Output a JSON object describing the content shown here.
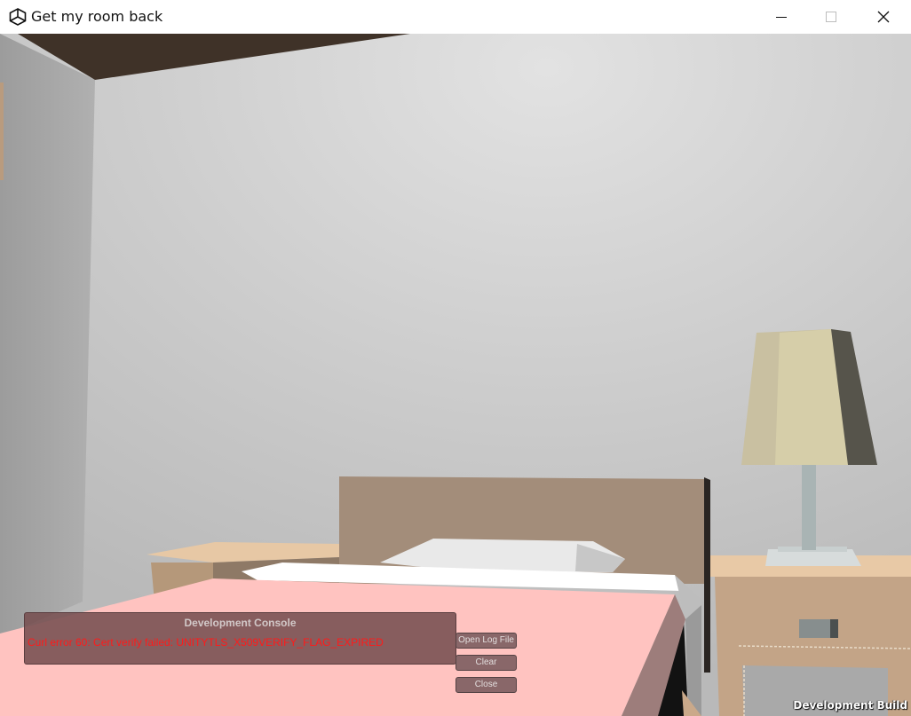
{
  "window": {
    "title": "Get my room back",
    "app_icon": "unity-logo-icon",
    "controls": {
      "minimize_icon": "minimize-icon",
      "maximize_icon": "maximize-icon",
      "close_icon": "close-icon"
    }
  },
  "console": {
    "title": "Development Console",
    "message": "Curl error 60: Cert verify failed: UNITYTLS_X509VERIFY_FLAG_EXPIRED",
    "message_color": "#ff1a1a",
    "buttons": {
      "open_log": "Open Log File",
      "clear": "Clear",
      "close": "Close"
    }
  },
  "build_label": "Development Build",
  "colors": {
    "ceiling": "#3f3228",
    "wall": "#d8d8d8",
    "bedspread": "#ffc3c0",
    "headboard": "#a38d7a",
    "lamp_shade": "#c9c0a1",
    "console_bg": "#764e50"
  }
}
